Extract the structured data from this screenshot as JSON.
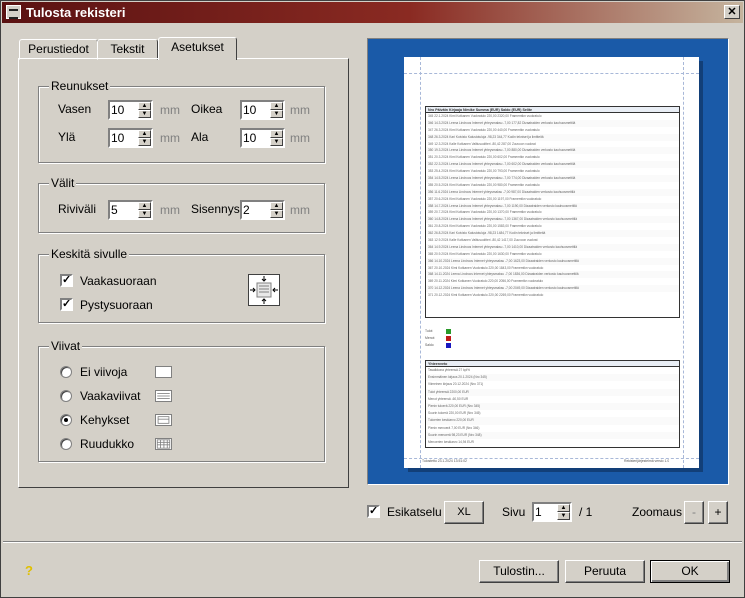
{
  "window": {
    "title": "Tulosta rekisteri"
  },
  "tabs": [
    {
      "label": "Perustiedot"
    },
    {
      "label": "Tekstit"
    },
    {
      "label": "Asetukset"
    }
  ],
  "margins": {
    "title": "Reunukset",
    "left_label": "Vasen",
    "left_value": "10",
    "right_label": "Oikea",
    "right_value": "10",
    "top_label": "Ylä",
    "top_value": "10",
    "bottom_label": "Ala",
    "bottom_value": "10",
    "unit": "mm"
  },
  "spacing": {
    "title": "Välit",
    "line_label": "Riviväli",
    "line_value": "5",
    "indent_label": "Sisennys",
    "indent_value": "2",
    "unit": "mm"
  },
  "center": {
    "title": "Keskitä sivulle",
    "horizontal_label": "Vaakasuoraan",
    "horizontal_checked": true,
    "vertical_label": "Pystysuoraan",
    "vertical_checked": true
  },
  "lines": {
    "title": "Viivat",
    "options": [
      {
        "label": "Ei viivoja",
        "selected": false
      },
      {
        "label": "Vaakaviivat",
        "selected": false
      },
      {
        "label": "Kehykset",
        "selected": true
      },
      {
        "label": "Ruudukko",
        "selected": false
      }
    ]
  },
  "preview": {
    "table_header": "Nro    Päivätn    Kirjaaja    Nimike    Summa (EUR)    Saldo (EUR)    Selite",
    "rows": [
      "345  22.1.2024  Kimi Kotkanen  Vuokratulo  220,00  2320,00  Framemtkn vuokratulo",
      "346  14.3.2024  Leena Lindroos  Internet yhteysmaksu  -7,00  177,82  Dizaatraiden verkosto kauhuosmettilä",
      "347  26.3.2024  Kimi Kotkanen  Vuokratulo  220,00  440,00  Framemtkn vuokratulo",
      "348  26.3.2024  Kari Koivisto  Kalustotuloja  -98,23  344,77  Kodin tekniset ja ilmitteitä",
      "349  12.3.2024  Kalle Kotkanen  Valitusuoltteri  -80,42  287,00  Zuuvoon vuokrat",
      "350  19.3.2024  Leena Lindroos  Internet yhteysmaksu  -7,00  880,00  Dizaatraiden verkosto kauhuosmettilä",
      "351  20.3.2024  Kimi Kotkanen  Vuokratulo  220,00  602,00  Framemtkn vuokratulo",
      "352  22.3.2024  Leena Lindroos  Internet yhteysmaksu  -7,00  602,00  Dizaatraiden verkosto kauhuosmettilä",
      "353  25.4.2024  Kimi Kotkanen  Vuokratulo  220,00  793,00  Framemtkn vuokratulo",
      "354  14.5.2024  Leena Lindroos  Internet yhteysmaksu  -7,00  774,00  Dizaatraiden verkosto kauhuosmettilä",
      "355  20.5.2024  Kimi Kotkanen  Vuokratulo  220,00  980,00  Framemtkn vuokratulo",
      "356  11.6.2024  Leena Lindroos  Internet yhteysmaksu  -7,00  987,00  Dizaatraiden verkosto kauhuosmettilä",
      "357  20.6.2024  Kimi Kotkanen  Vuokratulo  220,00  1197,00  Framemtkn vuokratulo",
      "358  14.7.2024  Leena Lindroos  Internet yhteysmaksu  -7,00  1190,00  Dizaatraiden verkosto kauhuosmettilä",
      "359  20.7.2024  Kimi Kotkanen  Vuokratulo  220,00  1370,00  Framemtkn vuokratulo",
      "360  14.8.2024  Leena Lindroos  Internet yhteysmaksu  -7,00  1367,00  Dizaatraiden verkosto kauhuosmettilä",
      "361  20.8.2024  Kimi Kotkanen  Vuokratulo  220,00  1583,00  Framemtkn vuokratulo",
      "362  26.8.2024  Kari Koivisto  Kalustotuloja  -98,23  1484,77  Kodin tekniset ja ilmitteitä",
      "363  12.9.2024  Kalle Kotkanen  Valitusuoltteri  -80,42  1417,00  Zuuvoon vuokrat",
      "364  14.9.2024  Leena Lindroos  Internet yhteysmaksu  -7,00  1410,00  Dizaatraiden verkosto kauhuosmettilä",
      "365  20.9.2024  Kimi Kotkanen  Vuokratulo  220,00  1630,00  Framemtkn vuokratulo",
      "366  14.10.2024  Leena Lindroos  Internet yhteysmaksu  -7,00  1623,00  Dizaatraiden verkosto kauhuosmettilä",
      "367  20.10.2024  Kimi Kotkanen  Vuokratulo  220,00  1843,00  Framemtkn vuokratulo",
      "368  14.11.2024  Leena Lindroos  Internet yhteysmaksu  -7,00  1836,00  Dizaatraiden verkosto kauhuosmettilä",
      "369  20.11.2024  Kimi Kotkanen  Vuokratulo  220,00  2056,00  Framemtkn vuokratulo",
      "370  14.12.2024  Leena Lindroos  Internet yhteysmaksu  -7,00  2049,00  Dizaatraiden verkosto kauhuosmettilä",
      "371  20.12.2024  Kimi Kotkanen  Vuokratulo  220,00  2269,00  Framemtkn vuokratulo"
    ],
    "legend": [
      "Tulot",
      "Menot",
      "Saldo"
    ],
    "legend_colors": [
      "#2a9a2a",
      "#c01818",
      "#1818c0"
    ],
    "summary_title": "Yhteenveto",
    "summary_rows": [
      "Tasaikkona yhteensä    27 kpl%",
      "Ensimmäinen kirjaus    20.1.2024    (Nro 345)",
      "Viimeinen kirjaus    20.12.2024    (Nro 371)",
      "Tulot yhteensä    2200,00 EUR",
      "Menot yhteensä    -60,50 EUR",
      "Pienin tuloerä    220,00 EUR    (Nro 345)",
      "Suurin tuloerä    220,00 EUR    (Nro 345)",
      "Tuloerien keskiarvo    220,00 EUR",
      "Pienin menoerä    7,00 EUR    (Nro 346)",
      "Suurin menoerä    98,23 EUR    (Nro 348)",
      "Menoerien keskiarvo    14,94 EUR"
    ],
    "footer_left": "Tulostettu 23.1.2024 13:51:02",
    "footer_right": "Rekisterijärjestelmä versio 1.0"
  },
  "bottom_bar": {
    "preview_label": "Esikatselu",
    "preview_checked": true,
    "xl_label": "XL",
    "page_label": "Sivu",
    "page_value": "1",
    "page_total": "/ 1",
    "zoom_label": "Zoomaus",
    "zoom_out": "-",
    "zoom_in": "+"
  },
  "buttons": {
    "help": "?",
    "printer": "Tulostin...",
    "cancel": "Peruuta",
    "ok": "OK"
  }
}
